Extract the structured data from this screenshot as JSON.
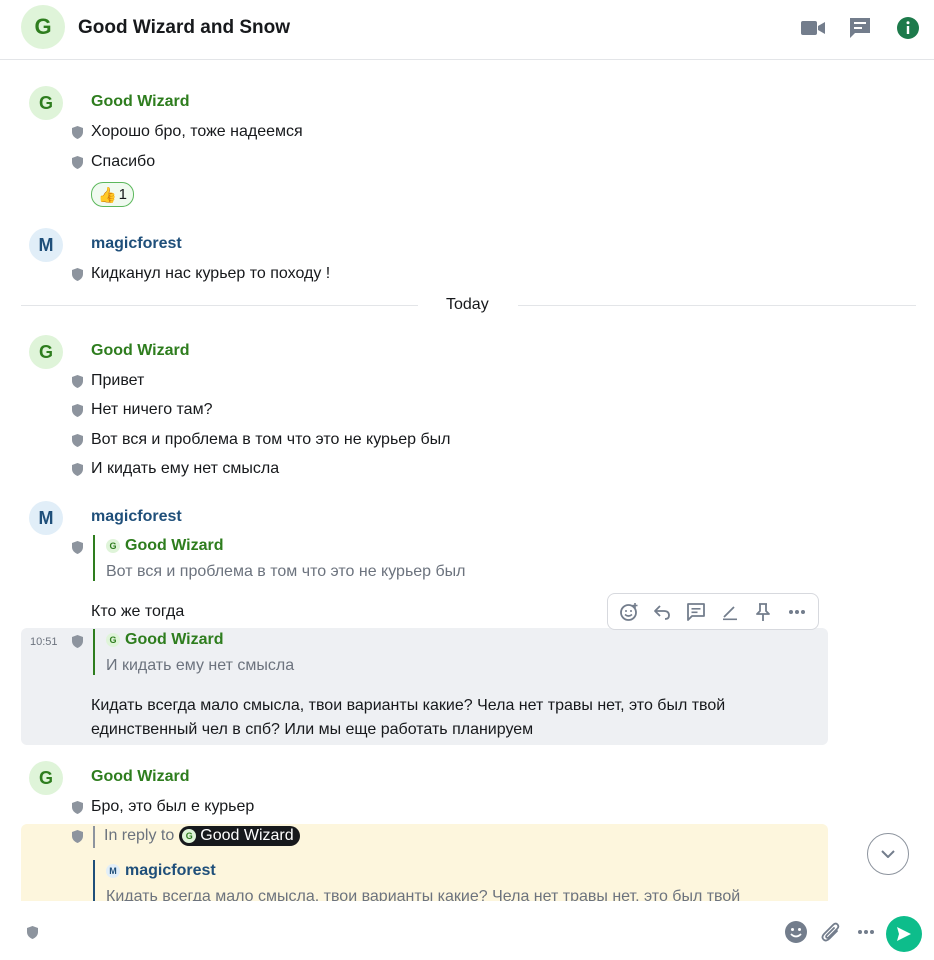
{
  "header": {
    "avatar_letter": "G",
    "room_title": "Good Wizard and Snow",
    "icons": [
      "video-call-icon",
      "threads-icon",
      "room-info-icon"
    ]
  },
  "timeline": {
    "group1": {
      "avatar_letter": "G",
      "sender": "Good Wizard",
      "messages": [
        "Хорошо бро, тоже надеемся",
        "Спасибо"
      ],
      "reaction": {
        "emoji": "👍",
        "count": "1"
      }
    },
    "group2": {
      "avatar_letter": "M",
      "sender": "magicforest",
      "messages": [
        "Кидканул нас курьер то походу !"
      ]
    },
    "date_divider": "Today",
    "group3": {
      "avatar_letter": "G",
      "sender": "Good Wizard",
      "messages": [
        "Привет",
        "Нет ничего там?",
        "Вот вся и проблема в том что это не курьер был",
        "И кидать ему нет смысла"
      ]
    },
    "group4": {
      "avatar_letter": "M",
      "sender": "magicforest",
      "reply1": {
        "quote_avatar_letter": "G",
        "quote_sender": "Good Wizard",
        "quote_text": "Вот вся и проблема в том что это не курьер был",
        "body": "Кто же тогда"
      },
      "reply2": {
        "timestamp": "10:51",
        "quote_avatar_letter": "G",
        "quote_sender": "Good Wizard",
        "quote_text": "И кидать ему нет смысла",
        "body_line1": "Кидать всегда мало смысла, твои варианты какие? Чела нет травы нет, это был твой",
        "body_line2": "единственный чел в спб? Или мы еще работать планируем"
      }
    },
    "group5": {
      "avatar_letter": "G",
      "sender": "Good Wizard",
      "messages": [
        "Бро, это был е курьер"
      ],
      "reply": {
        "in_reply_to_label": "In reply to",
        "in_reply_to_avatar_letter": "G",
        "in_reply_to_name": "Good Wizard",
        "quote_avatar_letter": "M",
        "quote_sender": "magicforest",
        "quote_text": "Кидать всегда мало смысла, твои варианты какие? Чела нет травы нет, это был твой"
      }
    }
  },
  "message_toolbar": [
    "react-icon",
    "reply-icon",
    "thread-icon",
    "edit-icon",
    "pin-icon",
    "more-options-icon"
  ],
  "composer": {
    "placeholder": "",
    "icons": [
      "emoji-icon",
      "attachment-icon",
      "more-options-icon",
      "send-icon"
    ]
  },
  "colors": {
    "accent": "#0dbd8b",
    "good_wizard": "#2e7d1e",
    "magicforest": "#1f4f7a"
  }
}
